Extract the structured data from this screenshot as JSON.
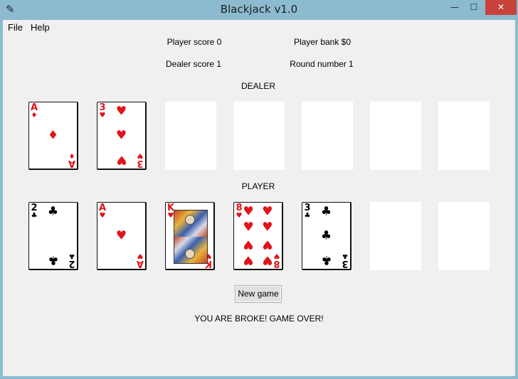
{
  "window": {
    "title": "Blackjack v1.0",
    "minimize": "—",
    "maximize": "☐",
    "close": "✕",
    "app_icon": "✎"
  },
  "menu": {
    "file": "File",
    "help": "Help"
  },
  "stats": {
    "player_score": "Player score 0",
    "player_bank": "Player bank $0",
    "dealer_score": "Dealer score 1",
    "round_number": "Round number 1"
  },
  "sections": {
    "dealer": "DEALER",
    "player": "PLAYER"
  },
  "dealer_cards": [
    {
      "rank": "A",
      "suit": "♦",
      "suit_name": "diamonds",
      "color": "red"
    },
    {
      "rank": "3",
      "suit": "♥",
      "suit_name": "hearts",
      "color": "red"
    },
    null,
    null,
    null,
    null,
    null
  ],
  "player_cards": [
    {
      "rank": "2",
      "suit": "♣",
      "suit_name": "clubs",
      "color": "black"
    },
    {
      "rank": "A",
      "suit": "♥",
      "suit_name": "hearts",
      "color": "red"
    },
    {
      "rank": "K",
      "suit": "♥",
      "suit_name": "hearts",
      "color": "red"
    },
    {
      "rank": "8",
      "suit": "♥",
      "suit_name": "hearts",
      "color": "red"
    },
    {
      "rank": "3",
      "suit": "♣",
      "suit_name": "clubs",
      "color": "black"
    },
    null,
    null
  ],
  "new_game_label": "New game",
  "status_message": "YOU ARE BROKE! GAME OVER!",
  "colors": {
    "red_suit": "#e0141a",
    "black_suit": "#000000",
    "titlebar": "#8cbbd0",
    "close": "#c8423b",
    "background": "#f0f0f0"
  }
}
